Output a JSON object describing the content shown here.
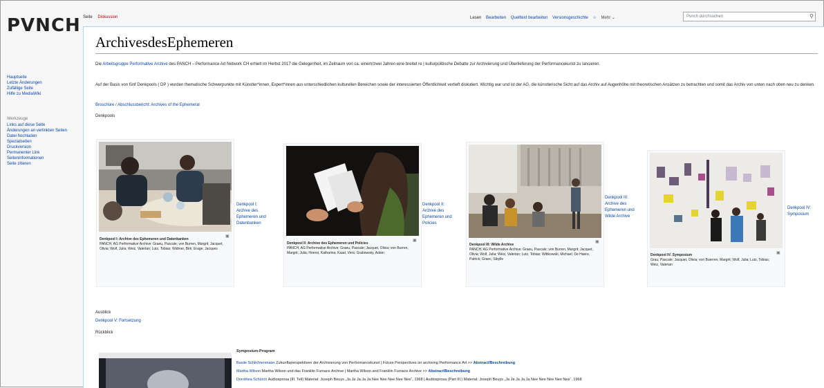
{
  "site": {
    "logo": "PVNCH"
  },
  "sidebar": {
    "nav": [
      "Hauptseite",
      "Letzte Änderungen",
      "Zufällige Seite",
      "Hilfe zu MediaWiki"
    ],
    "tools_heading": "Werkzeuge",
    "tools": [
      "Links auf diese Seite",
      "Änderungen an verlinkten Seiten",
      "Datei hochladen",
      "Spezialseiten",
      "Druckversion",
      "Permanenter Link",
      "Seiteninformationen",
      "Seite zitieren"
    ]
  },
  "tabs": {
    "page": "Seite",
    "discussion": "Diskussion",
    "read": "Lesen",
    "edit": "Bearbeiten",
    "edit_source": "Quelltext bearbeiten",
    "history": "Versionsgeschichte",
    "star": "☆",
    "more": "Mehr ⌄"
  },
  "search": {
    "placeholder": "Punch durchsuchen"
  },
  "page": {
    "title": "ArchivesdesEphemeren",
    "intro1_pre": "Die ",
    "intro1_link": "Arbeitsgruppe Performative Archive",
    "intro1_post": " des PANCH – Performance Art Network CH erhielt im Herbst 2017 die Gelegenheit, im Zeitraum von ca. einem/zwei Jahren eine breitet re | kulturpolitische Debatte zur Archivierung und Überlieferung der Performancekunst zu lancieren.",
    "intro2": "Auf der Basis von fünf Denkpools ( DP ) wurden thematische Schwerpunkte mit Künstler*innen, Expert*innen aus unterschiedlichen kulturellen Bereichen sowie der interessierten Öffentlichkeit vertieft diskutiert. Wichtig war und ist der AG, die künstlerische Sicht auf das Archiv auf Augenhöhe mit theoretischen Ansätzen zu betrachten und somit das Archiv von unten nach oben neu zu denken.",
    "brochure_link": "Broschüre / Abschlussbericht: Archives of the Ephemeral",
    "denkpools_heading": "Denkpools",
    "ausblick_heading": "Ausblick",
    "ausblick_link": "Denkpool V: Fortsetzung",
    "rueckblick_heading": "Rückblick"
  },
  "gallery": [
    {
      "caption_title": "Denkpool I: Archive des Ephemeren und Datenbanken",
      "caption_text": "PANCH, AG Performative Archive: Graeu, Pascale; von Burren, Margrit; Jacquet, Olivia; Wolf, Julia; Weiz, Valerian; Lutz, Tobias; Widmer, Birk; Erage, Jacques",
      "link": "Denkpool I: Archive des Ephemeren und Datenbanken"
    },
    {
      "caption_title": "Denkpool II: Archive des Ephemeren und Policies",
      "caption_text": "PANCH, AG Performative Archive: Graeu, Pascale; Jacquet, Olivia; von Burren, Margrit; Julia; Hoerst, Katharina; Kaad, Vera; Grabowsky, Adam",
      "link": "Denkpool II: Archive des Ephemeren und Policies"
    },
    {
      "caption_title": "Denkpool III: Wilde Archive",
      "caption_text": "PANCH, AG Performative Archive: Graeu, Pascale; von Burren, Margrit; Jacquet, Olivia; Wolf, Julia; Weiz, Valerian; Lutz, Tobias; Wittkowski, Michael; De Haere, Patrick; Graec, Sibylle",
      "link": "Denkpool III: Archive des Ephemeren und Wilde Archive"
    },
    {
      "caption_title": "Denkpool IV: Symposium",
      "caption_text": "Grau, Pascale; Jacquet, Olivia; von Buerren, Margrit; Wolf, Julia; Lutz, Tobias; Weiz, Valerian",
      "link": "Denkpool IV: Symposium"
    }
  ],
  "program": {
    "heading": "Symposium-Program",
    "rows": [
      {
        "person": "Basile Schlichtenmaier",
        "text": " Zukunftsperspektiven der Archivierung von Performancekunst | Future Perspectives on archiving Performance Art >> ",
        "link": "Abstract/Beschreibung"
      },
      {
        "person": "Martha Wilson",
        "text": " Martha Wilson und das Franklin Furnace Archive | Martha Wilson and Franklin Furnace Archive >> ",
        "link": "Abstract/Beschreibung"
      },
      {
        "person": "Dorothea Schürch",
        "text": " Audiosprosa (III. Teil) Material: Joseph Beuys „Ja Ja Ja Ja Ja Nee Nee Nee Nee Nee“, 1968 | Audiosprosa (Part III.) Material: Joseph Beuys „Ja Ja Ja Ja Ja Nee Nee Nee Nee Nee“, 1968",
        "link": ""
      }
    ]
  }
}
